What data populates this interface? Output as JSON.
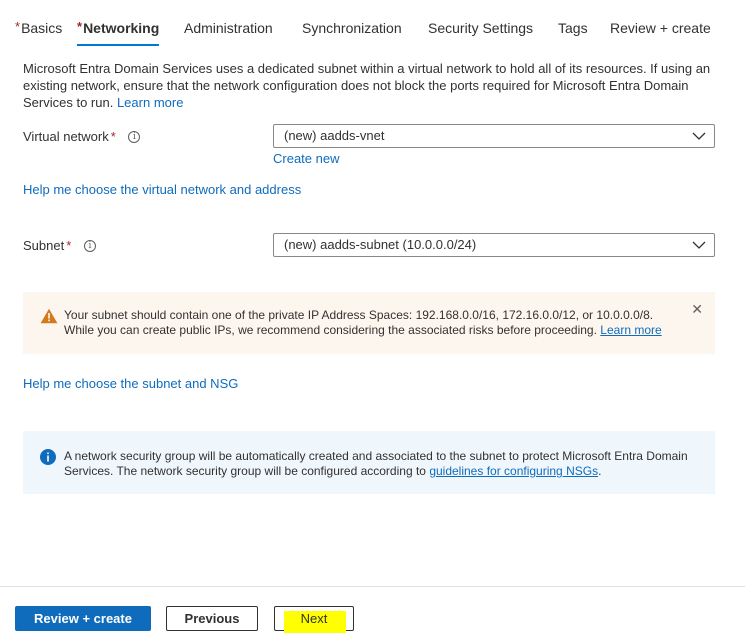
{
  "tabs": [
    {
      "label": "Basics",
      "required": true,
      "active": false
    },
    {
      "label": "Networking",
      "required": true,
      "active": true
    },
    {
      "label": "Administration",
      "required": false,
      "active": false
    },
    {
      "label": "Synchronization",
      "required": false,
      "active": false
    },
    {
      "label": "Security Settings",
      "required": false,
      "active": false
    },
    {
      "label": "Tags",
      "required": false,
      "active": false
    },
    {
      "label": "Review + create",
      "required": false,
      "active": false
    }
  ],
  "required_marker": "*",
  "intro": {
    "text": "Microsoft Entra Domain Services uses a dedicated subnet within a virtual network to hold all of its resources. If using an existing network, ensure that the network configuration does not block the ports required for Microsoft Entra Domain Services to run.",
    "link": "Learn more"
  },
  "virtual_network": {
    "label": "Virtual network",
    "value": "(new) aadds-vnet",
    "create_new": "Create new"
  },
  "help_vnet_link": "Help me choose the virtual network and address",
  "subnet": {
    "label": "Subnet",
    "value": "(new) aadds-subnet (10.0.0.0/24)"
  },
  "warning": {
    "text": "Your subnet should contain one of the private IP Address Spaces: 192.168.0.0/16, 172.16.0.0/12, or 10.0.0.0/8. While you can create public IPs, we recommend considering the associated risks before proceeding.",
    "link": "Learn more",
    "close_glyph": "✕"
  },
  "help_subnet_link": "Help me choose the subnet and NSG",
  "info": {
    "text_before": "A network security group will be automatically created and associated to the subnet to protect Microsoft Entra Domain Services. The network security group will be configured according to",
    "link": "guidelines for configuring NSGs",
    "text_after": "."
  },
  "footer": {
    "review_create": "Review + create",
    "previous": "Previous",
    "next": "Next"
  },
  "colors": {
    "accent": "#0f6cbd",
    "required": "#a4262c",
    "warning_bg": "#fdf6ee",
    "warning_icon": "#d47a1d",
    "info_bg": "#eff6fc",
    "highlight": "#ffff00"
  },
  "icons": {
    "info": "info-circle-icon",
    "warning": "warning-triangle-icon",
    "chevron": "chevron-down-icon",
    "close": "close-icon"
  }
}
